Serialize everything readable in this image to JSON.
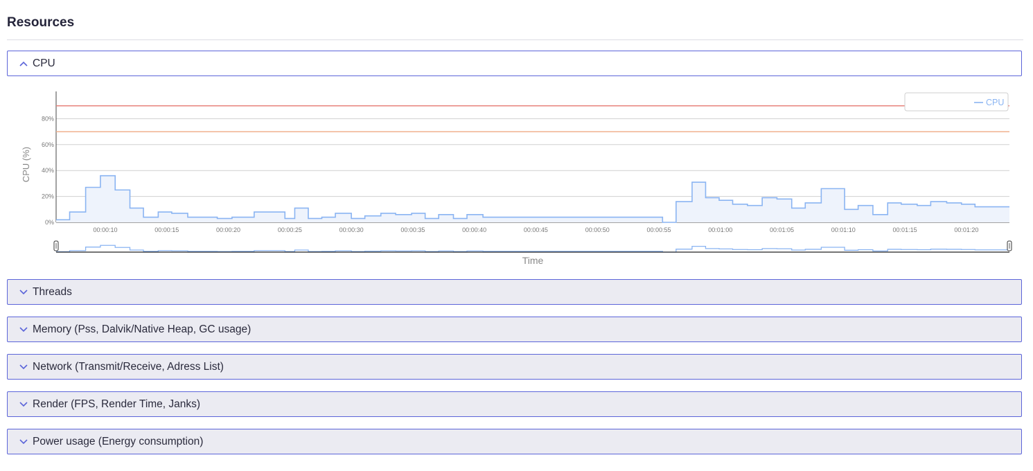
{
  "section_title": "Resources",
  "accordions": [
    {
      "label": "CPU",
      "expanded": true
    },
    {
      "label": "Threads",
      "expanded": false
    },
    {
      "label": "Memory (Pss, Dalvik/Native Heap, GC usage)",
      "expanded": false
    },
    {
      "label": "Network (Transmit/Receive, Adress List)",
      "expanded": false
    },
    {
      "label": "Render (FPS, Render Time, Janks)",
      "expanded": false
    },
    {
      "label": "Power usage (Energy consumption)",
      "expanded": false
    }
  ],
  "colors": {
    "accent": "#5b64d9",
    "series": "#8ab4f2",
    "series_fill": "#eef3fc",
    "threshold_high": "#e7837b",
    "threshold_mid": "#f0b08e",
    "closed_bg": "#ebebf2"
  },
  "chart_data": {
    "type": "area",
    "step": true,
    "ylabel": "CPU (%)",
    "xlabel": "Time",
    "y_ticks": [
      "0%",
      "20%",
      "40%",
      "60%",
      "80%"
    ],
    "x_ticks": [
      "00:00:10",
      "00:00:15",
      "00:00:20",
      "00:00:25",
      "00:00:30",
      "00:00:35",
      "00:00:40",
      "00:00:45",
      "00:00:50",
      "00:00:55",
      "00:01:00",
      "00:01:05",
      "00:01:10",
      "00:01:15",
      "00:01:20"
    ],
    "x_range_seconds": [
      6,
      83.5
    ],
    "y_range": [
      0,
      100
    ],
    "thresholds": [
      90,
      70
    ],
    "legend": {
      "entries": [
        "CPU"
      ],
      "position": "top-right"
    },
    "grid": true,
    "series": [
      {
        "name": "CPU",
        "x": [
          6,
          7.1,
          8.4,
          9.6,
          10.8,
          12,
          13.1,
          14.3,
          15.4,
          16.7,
          17.8,
          19.1,
          20.3,
          22.1,
          24.6,
          25.4,
          26.5,
          27.6,
          28.7,
          30,
          31.1,
          32.4,
          33.6,
          34.9,
          36,
          37.1,
          38.3,
          39.4,
          40.7,
          55.3,
          56.4,
          57.7,
          58.8,
          59.9,
          61,
          62.2,
          63.4,
          64.6,
          65.8,
          66.9,
          68.2,
          70.1,
          71.2,
          72.4,
          73.6,
          74.7,
          76,
          77.1,
          78.4,
          79.6,
          80.7,
          81.9
        ],
        "values": [
          2,
          8,
          27,
          36,
          25,
          11,
          4,
          8,
          7,
          4,
          4,
          3,
          4,
          8,
          3,
          11,
          3,
          4,
          7,
          3,
          5,
          7,
          6,
          7,
          3,
          6,
          3,
          6,
          4,
          0,
          16,
          31,
          19,
          17,
          14,
          13,
          19,
          18,
          11,
          15,
          26,
          10,
          13,
          6,
          15,
          14,
          13,
          16,
          15,
          14,
          12,
          12
        ]
      }
    ]
  }
}
